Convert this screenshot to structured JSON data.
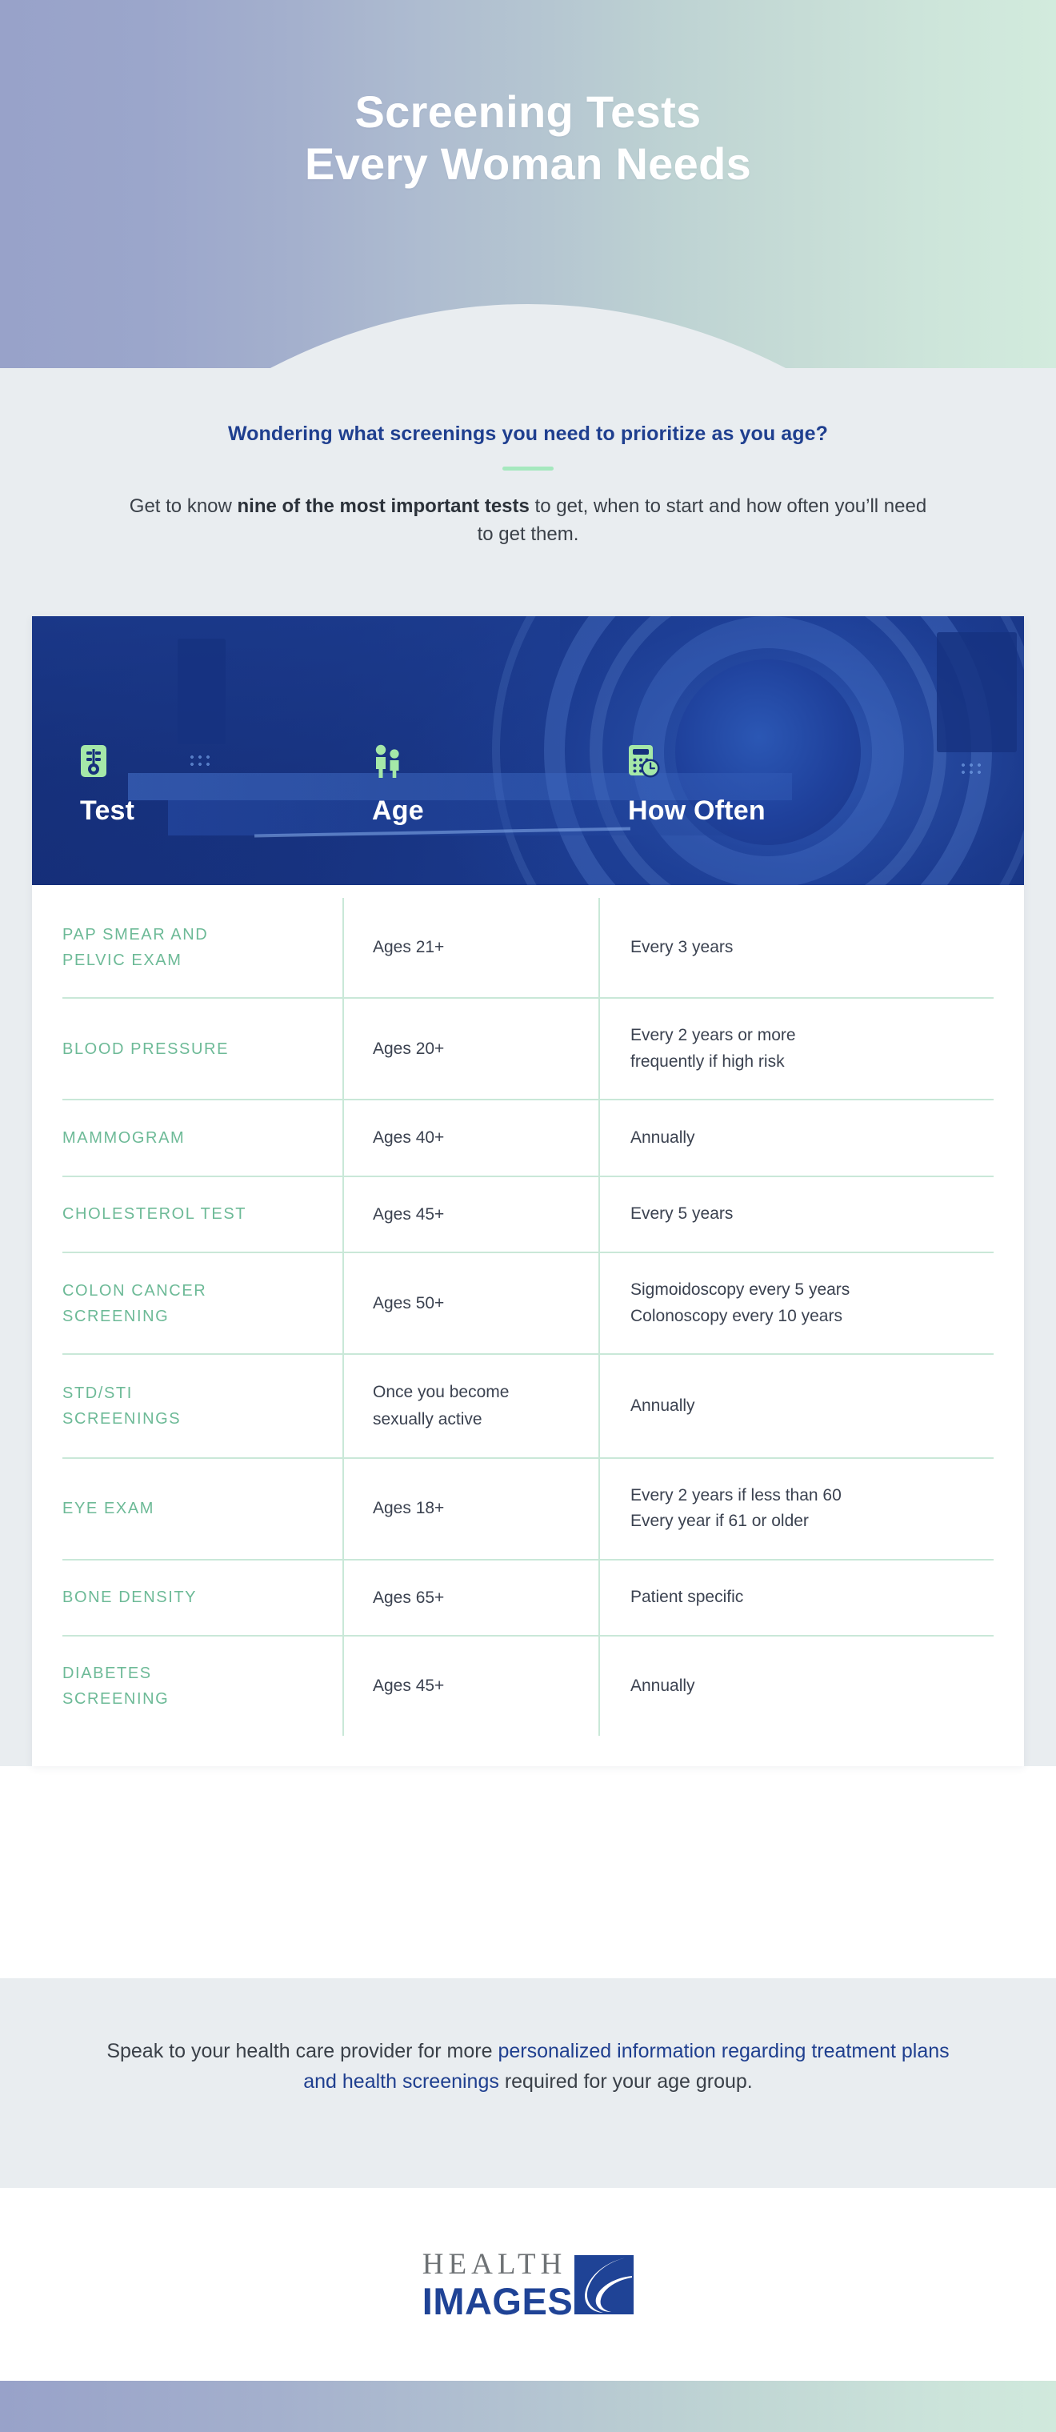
{
  "hero": {
    "title_line1": "Screening Tests",
    "title_line2": "Every Woman Needs",
    "gradient_from": "#98a2c9",
    "gradient_to": "#d2ebdd"
  },
  "intro": {
    "question": "Wondering what screenings you need to prioritize as you age?",
    "body_before": "Get to know ",
    "body_bold": "nine of the most important tests",
    "body_after": " to get, when to start and how often you’ll need to get them.",
    "rule_color": "#a5e8be"
  },
  "table": {
    "header": {
      "background_color": "#16307c",
      "columns": [
        {
          "label": "Test",
          "icon": "clipboard-test-icon"
        },
        {
          "label": "Age",
          "icon": "two-people-icon"
        },
        {
          "label": "How Often",
          "icon": "calculator-clock-icon"
        }
      ]
    },
    "accent_green": "#6dba97",
    "divider_green": "#c9e8d8",
    "rows": [
      {
        "test": [
          "PAP SMEAR AND",
          "PELVIC EXAM"
        ],
        "age": [
          "Ages 21+"
        ],
        "how_often": [
          "Every 3 years"
        ]
      },
      {
        "test": [
          "BLOOD PRESSURE"
        ],
        "age": [
          "Ages 20+"
        ],
        "how_often": [
          "Every 2 years or more",
          "frequently if high risk"
        ]
      },
      {
        "test": [
          "MAMMOGRAM"
        ],
        "age": [
          "Ages 40+"
        ],
        "how_often": [
          "Annually"
        ]
      },
      {
        "test": [
          "CHOLESTEROL TEST"
        ],
        "age": [
          "Ages 45+"
        ],
        "how_often": [
          "Every 5 years"
        ]
      },
      {
        "test": [
          "COLON CANCER",
          "SCREENING"
        ],
        "age": [
          "Ages 50+"
        ],
        "how_often": [
          "Sigmoidoscopy every 5 years",
          "Colonoscopy every 10 years"
        ]
      },
      {
        "test": [
          "STD/STI",
          "SCREENINGS"
        ],
        "age": [
          "Once you become",
          "sexually active"
        ],
        "how_often": [
          "Annually"
        ]
      },
      {
        "test": [
          "EYE EXAM"
        ],
        "age": [
          "Ages 18+"
        ],
        "how_often": [
          "Every 2 years if less than 60",
          "Every year if 61 or older"
        ]
      },
      {
        "test": [
          "BONE DENSITY"
        ],
        "age": [
          "Ages 65+"
        ],
        "how_often": [
          "Patient specific"
        ]
      },
      {
        "test": [
          "DIABETES",
          "SCREENING"
        ],
        "age": [
          "Ages 45+"
        ],
        "how_often": [
          "Annually"
        ]
      }
    ]
  },
  "footnote": {
    "before": "Speak to your health care provider for more ",
    "link": "personalized information regarding treatment plans and health screenings",
    "after": " required for your age group.",
    "link_color": "#1f3f8f"
  },
  "logo": {
    "word_top": "HEALTH",
    "word_bottom": "IMAGES",
    "mark": "swoosh-icon",
    "top_color": "#6e7275",
    "bottom_color": "#1f4396"
  }
}
